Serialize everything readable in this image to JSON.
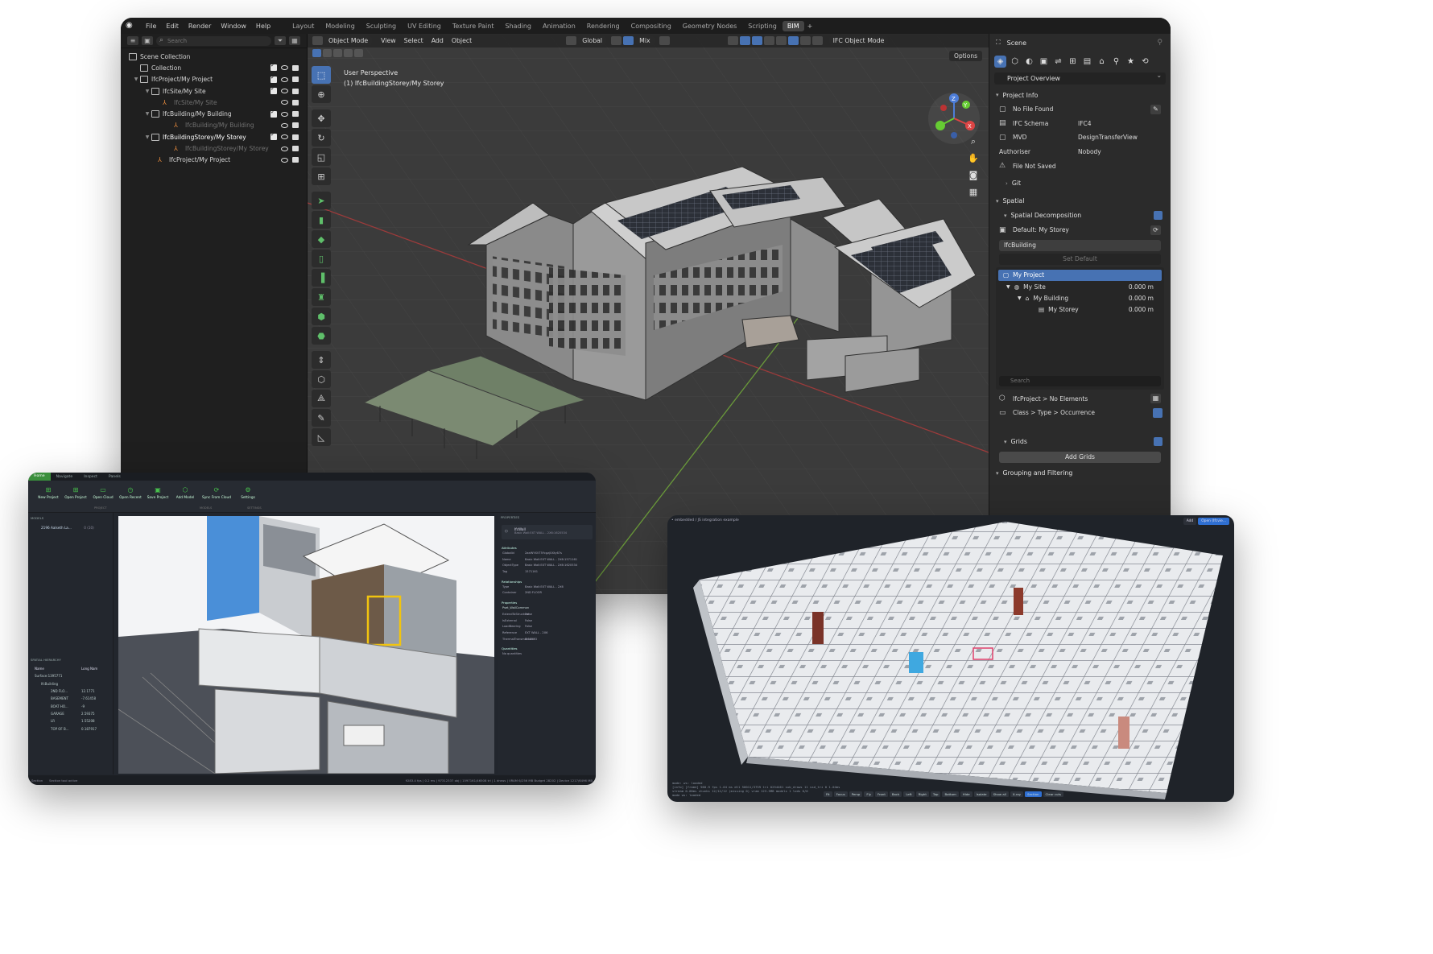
{
  "blender": {
    "menus": [
      "File",
      "Edit",
      "Render",
      "Window",
      "Help"
    ],
    "workspaces": [
      "Layout",
      "Modeling",
      "Sculpting",
      "UV Editing",
      "Texture Paint",
      "Shading",
      "Animation",
      "Rendering",
      "Compositing",
      "Geometry Nodes",
      "Scripting",
      "BIM"
    ],
    "active_workspace": "BIM",
    "outliner": {
      "search_placeholder": "Search",
      "items": [
        {
          "label": "Scene Collection"
        },
        {
          "label": "Collection"
        },
        {
          "label": "IfcProject/My Project"
        },
        {
          "label": "IfcSite/My Site"
        },
        {
          "label": "IfcSite/My Site"
        },
        {
          "label": "IfcBuilding/My Building"
        },
        {
          "label": "IfcBuilding/My Building"
        },
        {
          "label": "IfcBuildingStorey/My Storey"
        },
        {
          "label": "IfcBuildingStorey/My Storey"
        },
        {
          "label": "IfcProject/My Project"
        }
      ]
    },
    "viewport": {
      "mode": "Object Mode",
      "menus": [
        "View",
        "Select",
        "Add",
        "Object"
      ],
      "transform_orientation": "Global",
      "snap": "Mix",
      "ifc_mode": "IFC Object Mode",
      "options_label": "Options",
      "perspective_label": "User Perspective",
      "context_label": "(1) IfcBuildingStorey/My Storey",
      "gizmo_axes": [
        "Z",
        "Y",
        "X"
      ]
    },
    "properties": {
      "scene_label": "Scene",
      "panel_dropdown": "Project Overview",
      "project_info_title": "Project Info",
      "file_status": "No File Found",
      "schema_label": "IFC Schema",
      "schema_value": "IFC4",
      "mvd_label": "MVD",
      "mvd_value": "DesignTransferView",
      "authoriser_label": "Authoriser",
      "authoriser_value": "Nobody",
      "save_status": "File Not Saved",
      "git_label": "Git",
      "spatial_title": "Spatial",
      "spatial_decomposition": "Spatial Decomposition",
      "default_label": "Default: My Storey",
      "class_field": "IfcBuilding",
      "set_default": "Set Default",
      "tree": [
        {
          "label": "My Project",
          "value": ""
        },
        {
          "label": "My Site",
          "value": "0.000 m"
        },
        {
          "label": "My Building",
          "value": "0.000 m"
        },
        {
          "label": "My Storey",
          "value": "0.000 m"
        }
      ],
      "tree_search_placeholder": "Search",
      "elements_label": "IfcProject > No Elements",
      "class_type_label": "Class > Type > Occurrence",
      "grids_title": "Grids",
      "add_grids": "Add Grids",
      "grouping_title": "Grouping and Filtering"
    }
  },
  "viewer": {
    "tabs": [
      "Home",
      "Navigate",
      "Inspect",
      "Panels"
    ],
    "ribbon": [
      {
        "label": "New Project"
      },
      {
        "label": "Open Project"
      },
      {
        "label": "Open Cloud"
      },
      {
        "label": "Open Recent"
      },
      {
        "label": "Save Project"
      },
      {
        "label": "Add Model"
      },
      {
        "label": "Sync From Cloud"
      },
      {
        "label": "Settings"
      }
    ],
    "ribbon_groups": [
      "PROJECT",
      "MODELS",
      "SETTINGS"
    ],
    "models_title": "MODELS",
    "model_item": "2196 Aalseth La...",
    "model_count": "0 (10)",
    "hierarchy_title": "SPATIAL HIERARCHY",
    "hierarchy_cols": [
      "Name",
      "Long Nam"
    ],
    "hierarchy": [
      {
        "name": "Surface:1395771",
        "value": ""
      },
      {
        "name": "IfcBuilding",
        "value": ""
      },
      {
        "name": "2ND FLO...",
        "value": "12.1771"
      },
      {
        "name": "BASEMENT",
        "value": "-7.61458"
      },
      {
        "name": "BOAT HO...",
        "value": "-9"
      },
      {
        "name": "GARAGE",
        "value": "2.59375"
      },
      {
        "name": "LR",
        "value": "1.55208"
      },
      {
        "name": "TOP OF B...",
        "value": "0.187917"
      }
    ],
    "properties_title": "PROPERTIES",
    "selected_class": "IfcWall",
    "selected_name": "Basic Wall:EXT WALL - 2X6:1620534",
    "attributes_title": "Attributes",
    "attributes": [
      {
        "k": "GlobalId",
        "v": "2aeWYXVT5Ycgzj0Xty67s"
      },
      {
        "k": "Name",
        "v": "Basic Wall:EXT WALL - 2X6:1571161"
      },
      {
        "k": "ObjectType",
        "v": "Basic Wall:EXT WALL - 2X6:1620534"
      },
      {
        "k": "Tag",
        "v": "1571161"
      }
    ],
    "relationships_title": "Relationships",
    "relationships": [
      {
        "k": "Type",
        "v": "Basic Wall:EXT WALL - 2X6"
      },
      {
        "k": "Container",
        "v": "2ND FLOOR"
      }
    ],
    "properties_section": "Properties",
    "pset_name": "Pset_WallCommon",
    "pset": [
      {
        "k": "ExtendToStructure",
        "v": "False"
      },
      {
        "k": "IsExternal",
        "v": "False"
      },
      {
        "k": "LoadBearing",
        "v": "False"
      },
      {
        "k": "Reference",
        "v": "EXT WALL - 2X6"
      },
      {
        "k": "ThermalTransmittance",
        "v": "0.02533"
      }
    ],
    "quantities_title": "Quantities",
    "quantities_empty": "No quantities",
    "status_left": "Section",
    "status_mode": "Section tool active",
    "status_right": "9283.4 fps | 0.2 ms | 97312337 obj | 1597161/46508 tri | 1 draws | VRAM 6/256 MB Budget 28202 | Device 1217/6496 MB"
  },
  "web": {
    "breadcrumb": "• embedded / JS integration example",
    "buttons": [
      "Add",
      "Open (Ifcvie..."
    ],
    "hud": [
      "mode: ws: loaded",
      "[info] [frame] 960.9 fps  1.04 ms  dt1 50011/3759  tri 0254461  sub_draws 11  ssd_tri 0  1.04ms",
      "stream 0.00ms  chunks 12/12/12 (missing 0)  vram 123.5MB  models 1  lods 0/0",
      "mode ws: loaded"
    ],
    "toolbar": [
      "Fit",
      "Focus",
      "Persp",
      "Fly",
      "Front",
      "Back",
      "Left",
      "Right",
      "Top",
      "Bottom",
      "Hide",
      "Isolate",
      "Show all",
      "X-ray",
      "Section",
      "Clear cuts"
    ],
    "toolbar_active": "Section"
  }
}
